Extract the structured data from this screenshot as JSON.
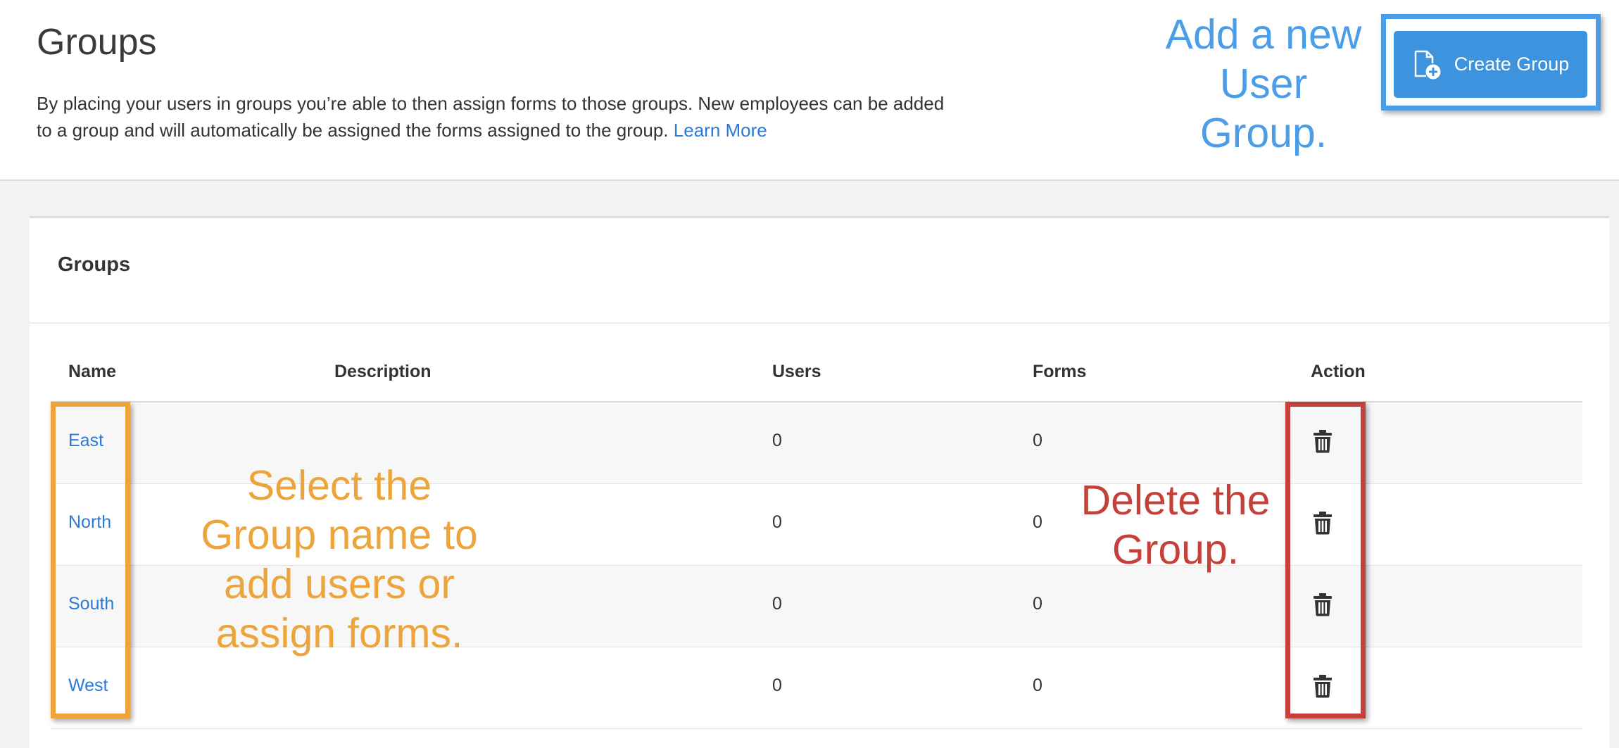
{
  "header": {
    "title": "Groups",
    "description": "By placing your users in groups you’re able to then assign forms to those groups. New employees can be added to a group and will automatically be assigned the forms assigned to the group.",
    "learn_more": "Learn More",
    "create_button": "Create Group"
  },
  "callouts": {
    "create": [
      "Add a new",
      "User",
      "Group."
    ],
    "select": [
      "Select the",
      "Group name to",
      "add users or",
      "assign forms."
    ],
    "delete": [
      "Delete the",
      "Group."
    ]
  },
  "panel": {
    "title": "Groups",
    "columns": [
      "Name",
      "Description",
      "Users",
      "Forms",
      "Action"
    ],
    "rows": [
      {
        "name": "East",
        "description": "",
        "users": "0",
        "forms": "0"
      },
      {
        "name": "North",
        "description": "",
        "users": "0",
        "forms": "0"
      },
      {
        "name": "South",
        "description": "",
        "users": "0",
        "forms": "0"
      },
      {
        "name": "West",
        "description": "",
        "users": "0",
        "forms": "0"
      }
    ]
  },
  "icons": {
    "create": "document-plus-icon",
    "delete": "trash-icon"
  },
  "colors": {
    "accent": "#3d93dd",
    "link": "#2a7ad8",
    "callout_blue": "#4a9de6",
    "callout_orange": "#eda43a",
    "callout_red": "#c44038"
  }
}
